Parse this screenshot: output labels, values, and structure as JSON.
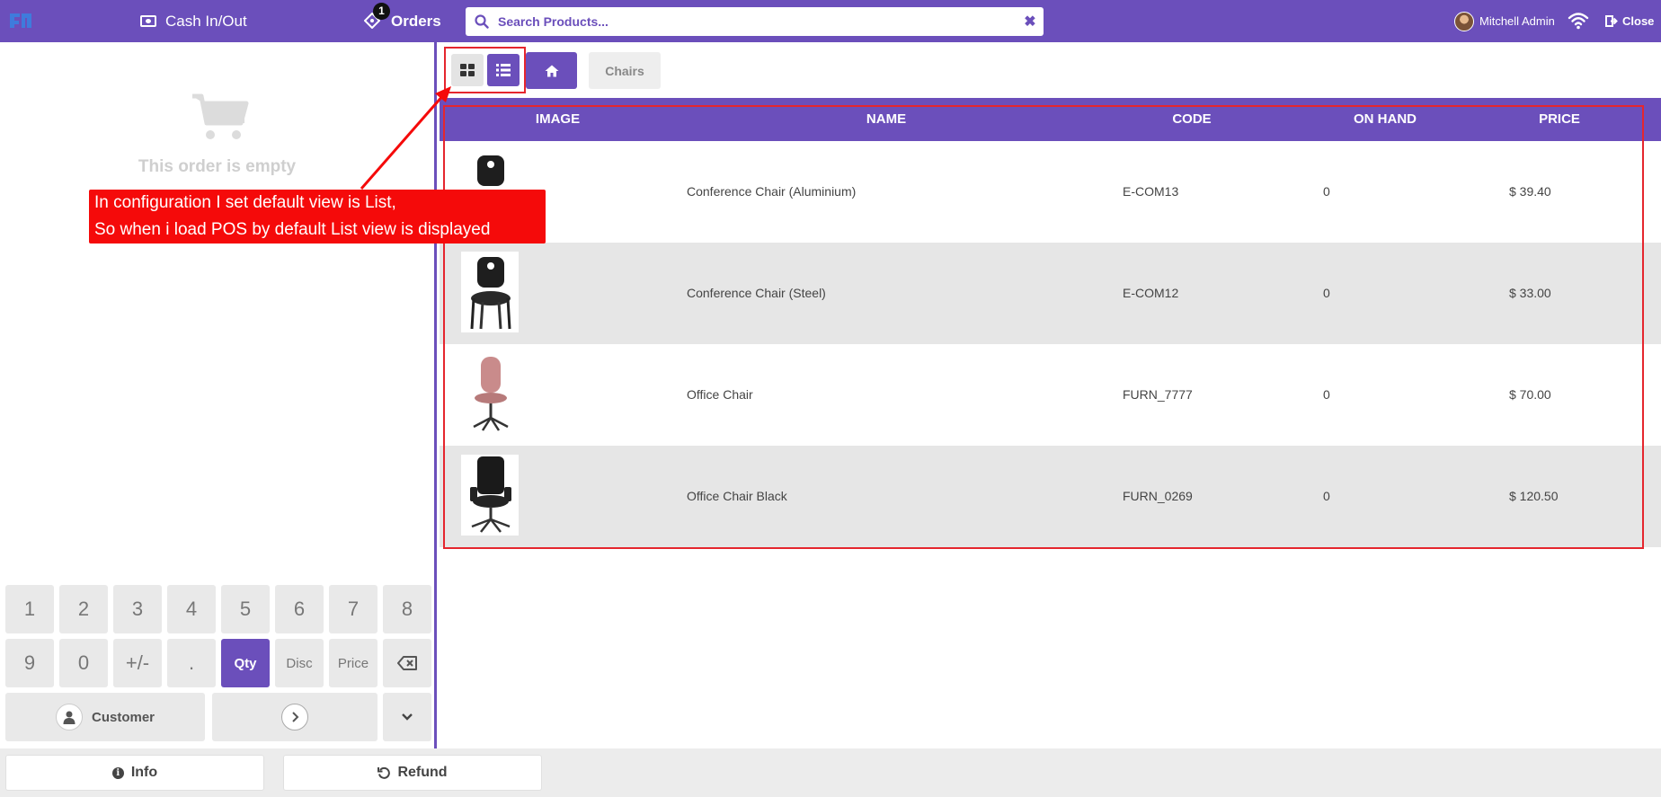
{
  "topbar": {
    "cash_label": "Cash In/Out",
    "orders_label": "Orders",
    "orders_badge": "1",
    "search_placeholder": "Search Products...",
    "user_name": "Mitchell Admin",
    "close_label": "Close"
  },
  "order": {
    "empty_text": "This order is empty"
  },
  "numpad": {
    "keys": [
      "1",
      "2",
      "3",
      "4",
      "5",
      "6",
      "7",
      "8",
      "9",
      "0",
      "+/-",
      ".",
      "Qty",
      "Disc",
      "Price"
    ],
    "active_mode": "Qty",
    "customer_label": "Customer"
  },
  "bottombar": {
    "info_label": "Info",
    "refund_label": "Refund"
  },
  "breadcrumb": {
    "category": "Chairs"
  },
  "product_table": {
    "headers": {
      "image": "IMAGE",
      "name": "NAME",
      "code": "CODE",
      "on_hand": "ON HAND",
      "price": "PRICE"
    },
    "rows": [
      {
        "name": "Conference Chair (Aluminium)",
        "code": "E-COM13",
        "on_hand": "0",
        "price": "$ 39.40",
        "image": "black-conference-chair"
      },
      {
        "name": "Conference Chair (Steel)",
        "code": "E-COM12",
        "on_hand": "0",
        "price": "$ 33.00",
        "image": "black-conference-chair"
      },
      {
        "name": "Office Chair",
        "code": "FURN_7777",
        "on_hand": "0",
        "price": "$ 70.00",
        "image": "pink-office-chair"
      },
      {
        "name": "Office Chair Black",
        "code": "FURN_0269",
        "on_hand": "0",
        "price": "$ 120.50",
        "image": "black-executive-chair"
      }
    ]
  },
  "annotation": {
    "line1": "In configuration I set default view is List,",
    "line2": "So when i load POS by default List view is displayed"
  },
  "colors": {
    "brand": "#6b4fbb",
    "annotation": "#f50a0a",
    "highlight_border": "#e5262e",
    "row_alt": "#e6e6e6"
  }
}
